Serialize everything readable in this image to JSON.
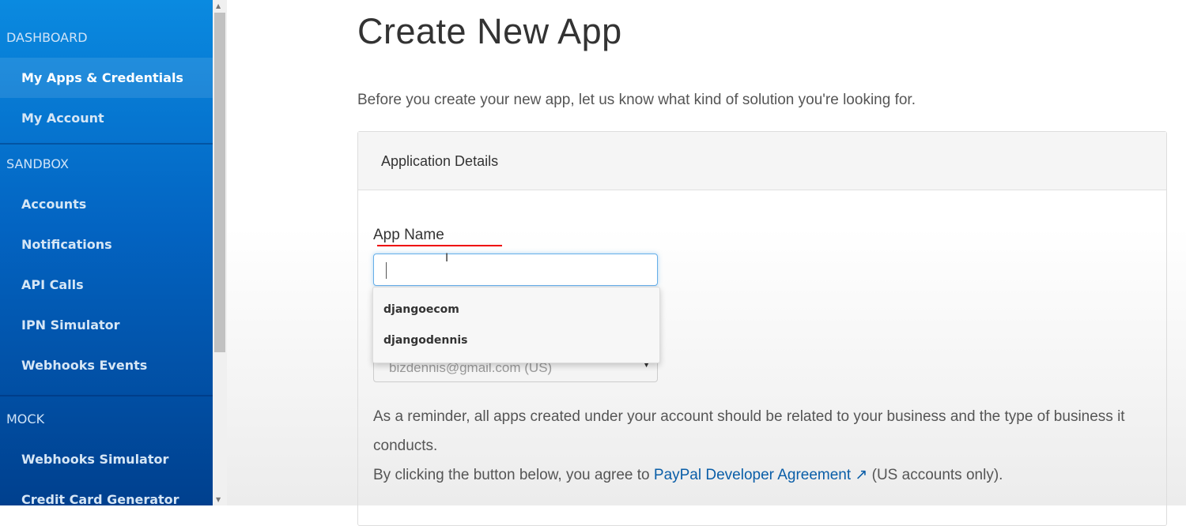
{
  "sidebar": {
    "sections": [
      {
        "title": "DASHBOARD",
        "items": [
          "My Apps & Credentials",
          "My Account"
        ]
      },
      {
        "title": "SANDBOX",
        "items": [
          "Accounts",
          "Notifications",
          "API Calls",
          "IPN Simulator",
          "Webhooks Events"
        ]
      },
      {
        "title": "MOCK",
        "items": [
          "Webhooks Simulator",
          "Credit Card Generator"
        ]
      }
    ],
    "active": "My Apps & Credentials"
  },
  "main": {
    "title": "Create New App",
    "intro": "Before you create your new app, let us know what kind of solution you're looking for.",
    "panel_title": "Application Details",
    "app_name_label": "App Name",
    "app_name_value": "",
    "autocomplete": [
      "djangoecom",
      "djangodennis"
    ],
    "sandbox_account": "bizdennis@gmail.com (US)",
    "reminder": "As a reminder, all apps created under your account should be related to your business and the type of business it conducts.",
    "agree_prefix": "By clicking the button below, you agree to ",
    "agree_link": "PayPal Developer Agreement",
    "agree_suffix": " (US accounts only)."
  }
}
